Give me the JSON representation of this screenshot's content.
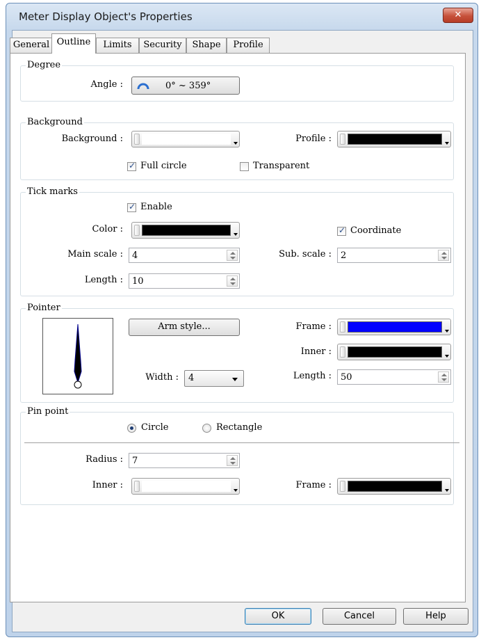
{
  "window": {
    "title": "Meter Display Object's Properties",
    "close_label": "✕"
  },
  "tabs": [
    {
      "label": "General"
    },
    {
      "label": "Outline"
    },
    {
      "label": "Limits"
    },
    {
      "label": "Security"
    },
    {
      "label": "Shape"
    },
    {
      "label": "Profile"
    }
  ],
  "active_tab": "Outline",
  "degree": {
    "title": "Degree",
    "angle_label": "Angle :",
    "angle_button": "0° ~ 359°"
  },
  "background": {
    "title": "Background",
    "background_label": "Background :",
    "background_color": "#ffffff",
    "profile_label": "Profile :",
    "profile_color": "#000000",
    "full_circle_label": "Full circle",
    "full_circle_checked": true,
    "transparent_label": "Transparent",
    "transparent_checked": false
  },
  "tick_marks": {
    "title": "Tick marks",
    "enable_label": "Enable",
    "enable_checked": true,
    "color_label": "Color :",
    "color": "#000000",
    "coordinate_label": "Coordinate",
    "coordinate_checked": true,
    "main_scale_label": "Main scale :",
    "main_scale_value": "4",
    "sub_scale_label": "Sub. scale :",
    "sub_scale_value": "2",
    "length_label": "Length :",
    "length_value": "10"
  },
  "pointer": {
    "title": "Pointer",
    "arm_style_label": "Arm style...",
    "width_label": "Width :",
    "width_value": "4",
    "frame_label": "Frame :",
    "frame_color": "#0000ff",
    "inner_label": "Inner :",
    "inner_color": "#000000",
    "length_label": "Length :",
    "length_value": "50"
  },
  "pin_point": {
    "title": "Pin point",
    "circle_label": "Circle",
    "circle_selected": true,
    "rectangle_label": "Rectangle",
    "radius_label": "Radius :",
    "radius_value": "7",
    "inner_label": "Inner :",
    "inner_color": "#ffffff",
    "frame_label": "Frame :",
    "frame_color": "#000000"
  },
  "buttons": {
    "ok": "OK",
    "cancel": "Cancel",
    "help": "Help"
  }
}
